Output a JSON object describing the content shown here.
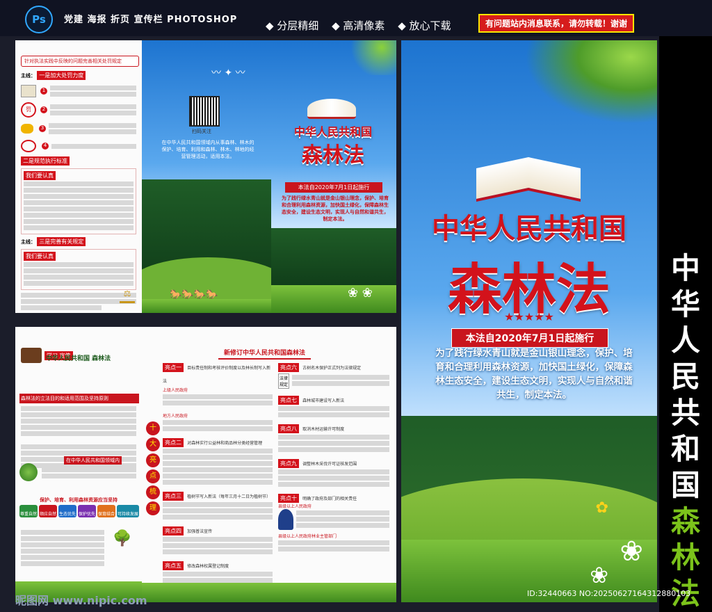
{
  "header": {
    "ps_label": "Ps",
    "tagline": "党建 海报 折页 宣传栏  PHOTOSHOP",
    "features": [
      "◆ 分层精细",
      "◆ 高清像素",
      "◆ 放心下载"
    ],
    "notice": "有问题站内消息联系，请勿转载！谢谢"
  },
  "cover": {
    "title1": "中华人民共和国",
    "title2": "森林法",
    "stars": "★★★★★",
    "effective": "本法自2020年7月1日起施行",
    "intro": "为了践行绿水青山就是金山银山理念，保护、培育和合理利用森林资源，加快国土绿化，保障森林生态安全，建设生态文明，实现人与自然和谐共生，制定本法。"
  },
  "small_cover": {
    "title1": "中华人民共和国",
    "title2": "森林法",
    "effective": "本法自2020年7月1日起施行",
    "intro": "为了践行绿水青山就是金山银山理念，保护、培育和合理利用森林资源，加快国土绿化，保障森林生态安全，建设生态文明，实现人与自然和谐共生，制定本法。",
    "scan": "扫码关注",
    "applies": "在中华人民共和国领域内从事森林、林木的保护、培育、利用和森林、林木、林地的经营管理活动，适用本法。"
  },
  "left_panel": {
    "header": "针对执法实践中反映的问题完善相关处罚规定",
    "line1_label": "主线：",
    "line1": "一是加大处罚力度",
    "line2": "二是规范执行标准",
    "line3": "三是完善有关规定",
    "we_focus": "我们要认真",
    "items": [
      "1",
      "2",
      "3",
      "4"
    ]
  },
  "inside_left": {
    "study": "学习 宣传",
    "law_name": "中华人民共和国 森林法",
    "section1": "森林法的立法目的和适用范围及坚持原则",
    "section2": "在中华人民共和国领域内",
    "principles_title": "保护、培育、利用森林资源应当坚持",
    "principles": [
      "尊重自然",
      "顺应自然",
      "生态优先",
      "保护优先",
      "保育结合",
      "可持续发展"
    ]
  },
  "inside_right": {
    "banner": "新修订中华人民共和国森林法",
    "ten_highlights": [
      "十",
      "大",
      "亮",
      "点",
      "梳",
      "理"
    ],
    "highlights": [
      {
        "label": "亮点一",
        "text": "目标责任制和考核评价制度以及林长制写入新法"
      },
      {
        "label": "亮点二",
        "text": "对森林实行公益林和商品林分类经营管理"
      },
      {
        "label": "亮点三",
        "text": "植树节写入新法（每年三月十二日为植树节）"
      },
      {
        "label": "亮点四",
        "text": "加强普法宣传"
      },
      {
        "label": "亮点五",
        "text": "修改森林权属登记制度"
      },
      {
        "label": "亮点六",
        "text": "古树名木保护正式列为法律规定"
      },
      {
        "label": "亮点七",
        "text": "森林城市建设写入新法"
      },
      {
        "label": "亮点八",
        "text": "取消木材运输许可制度"
      },
      {
        "label": "亮点九",
        "text": "调整林木采伐许可证核发范围"
      },
      {
        "label": "亮点十",
        "text": "明确了政府及部门的相关责任"
      }
    ],
    "gov_upper": "上级人民政府",
    "gov_local": "地方人民政府",
    "gov_above": "县级以上人民政府",
    "gov_forestry": "县级以上人民政府林业主管部门",
    "law_box": [
      "法律",
      "规定"
    ]
  },
  "right_band": {
    "lines": [
      "中",
      "华",
      "人",
      "民",
      "共",
      "和",
      "国"
    ],
    "green": [
      "森",
      "林",
      "法"
    ]
  },
  "footer": {
    "watermark": "昵图网 www.nipic.com",
    "id": "ID:32440663 NO:20250627164312880103"
  }
}
